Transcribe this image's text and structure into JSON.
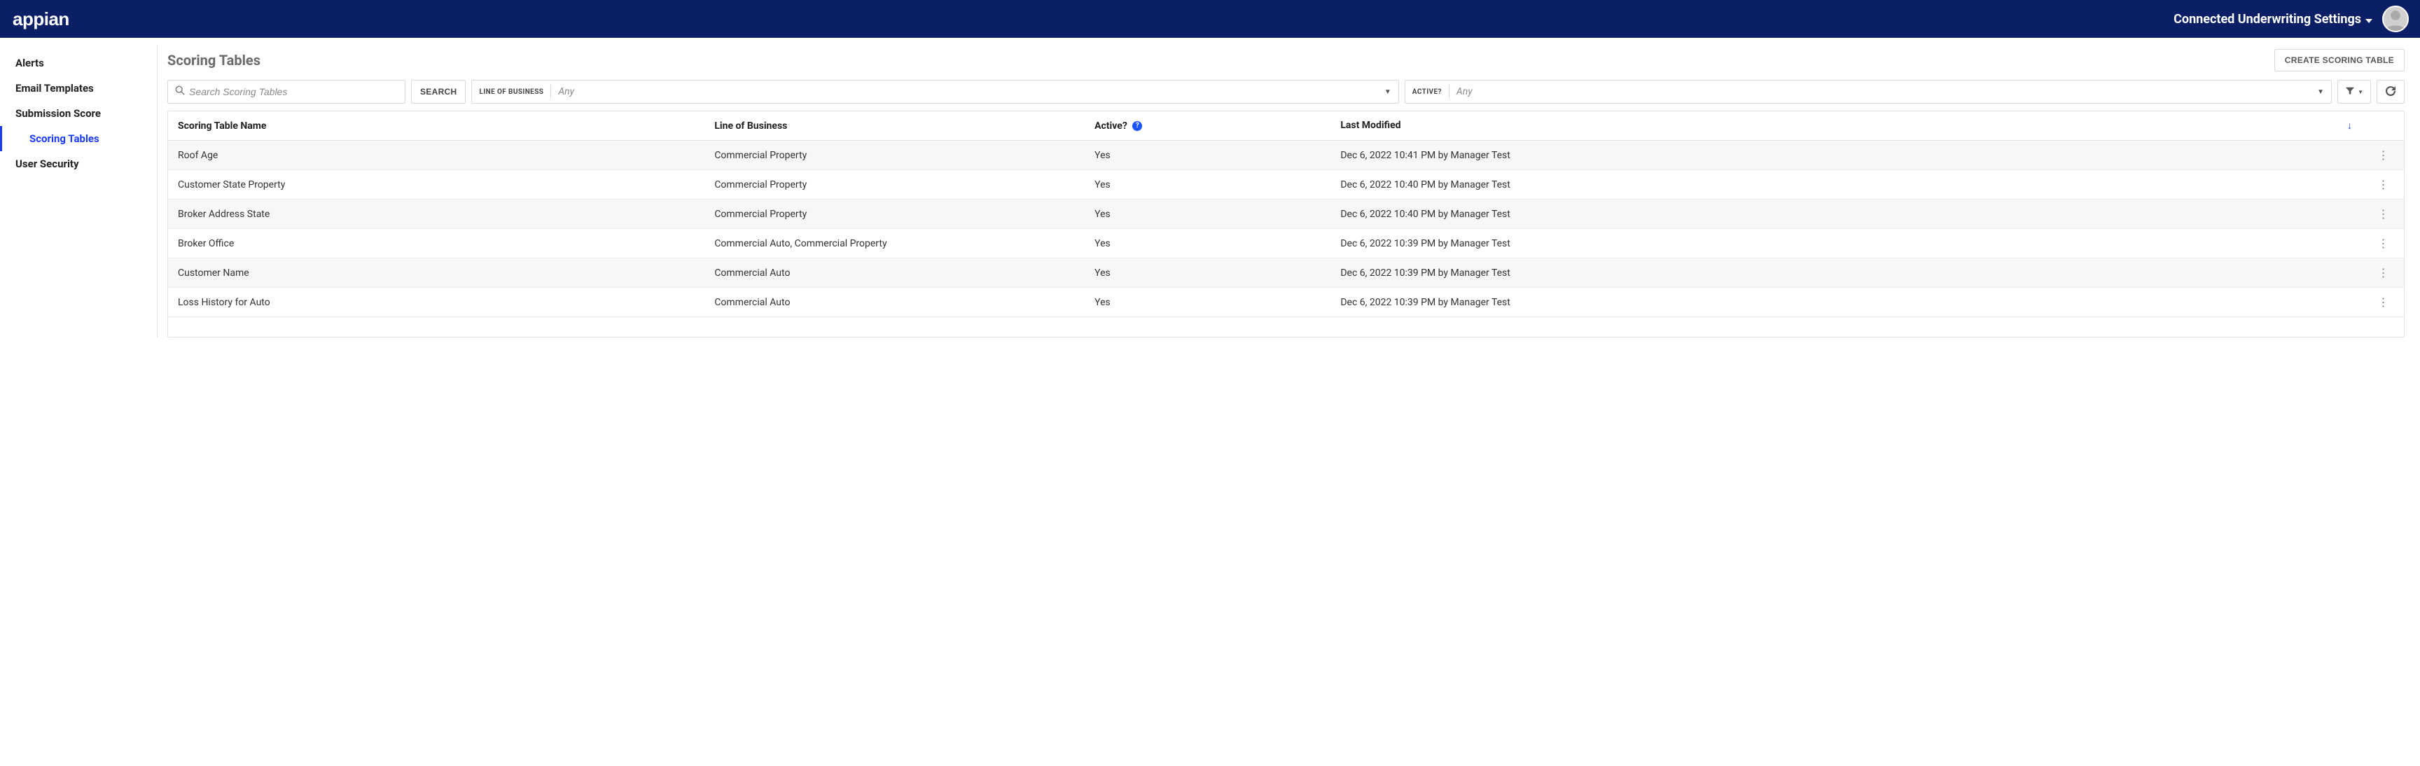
{
  "header": {
    "brand": "appian",
    "site_title": "Connected Underwriting Settings"
  },
  "sidebar": {
    "items": [
      {
        "label": "Alerts",
        "active": false,
        "child": false
      },
      {
        "label": "Email Templates",
        "active": false,
        "child": false
      },
      {
        "label": "Submission Score",
        "active": false,
        "child": false
      },
      {
        "label": "Scoring Tables",
        "active": true,
        "child": true
      },
      {
        "label": "User Security",
        "active": false,
        "child": false
      }
    ]
  },
  "page": {
    "title": "Scoring Tables",
    "create_button": "CREATE SCORING TABLE"
  },
  "filters": {
    "search_placeholder": "Search Scoring Tables",
    "search_button": "SEARCH",
    "lob_label": "LINE OF BUSINESS",
    "lob_value": "Any",
    "active_label": "ACTIVE?",
    "active_value": "Any"
  },
  "table": {
    "columns": {
      "name": "Scoring Table Name",
      "lob": "Line of Business",
      "active": "Active?",
      "modified": "Last Modified"
    },
    "rows": [
      {
        "name": "Roof Age",
        "lob": "Commercial Property",
        "active": "Yes",
        "modified": "Dec 6, 2022 10:41 PM by Manager Test"
      },
      {
        "name": "Customer State Property",
        "lob": "Commercial Property",
        "active": "Yes",
        "modified": "Dec 6, 2022 10:40 PM by Manager Test"
      },
      {
        "name": "Broker Address State",
        "lob": "Commercial Property",
        "active": "Yes",
        "modified": "Dec 6, 2022 10:40 PM by Manager Test"
      },
      {
        "name": "Broker Office",
        "lob": "Commercial Auto, Commercial Property",
        "active": "Yes",
        "modified": "Dec 6, 2022 10:39 PM by Manager Test"
      },
      {
        "name": "Customer Name",
        "lob": "Commercial Auto",
        "active": "Yes",
        "modified": "Dec 6, 2022 10:39 PM by Manager Test"
      },
      {
        "name": "Loss History for Auto",
        "lob": "Commercial Auto",
        "active": "Yes",
        "modified": "Dec 6, 2022 10:39 PM by Manager Test"
      }
    ]
  }
}
